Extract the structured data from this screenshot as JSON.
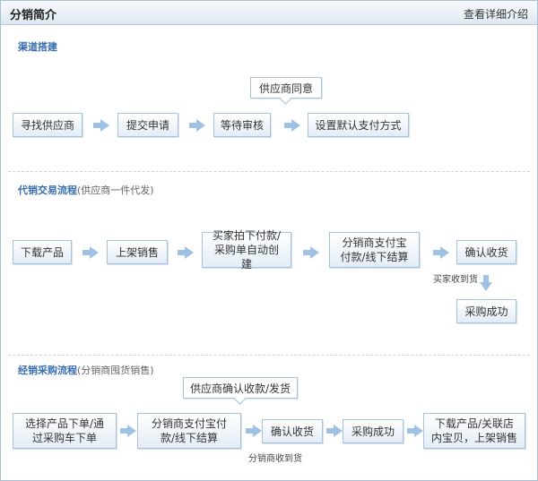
{
  "header": {
    "title": "分销简介",
    "details_link": "查看详细介绍"
  },
  "sections": {
    "channel": {
      "title": "渠道搭建",
      "callout": "供应商同意",
      "steps": [
        "寻找供应商",
        "提交申请",
        "等待审核",
        "设置默认支付方式"
      ]
    },
    "consignment": {
      "title": "代销交易流程",
      "subtitle": "(供应商一件代发)",
      "steps": [
        "下载产品",
        "上架销售",
        "买家拍下付款/采购单自动创建",
        "分销商支付宝付款/线下结算",
        "确认收货",
        "采购成功"
      ],
      "note": "买家收到货"
    },
    "distribution": {
      "title": "经销采购流程",
      "subtitle": "(分销商囤货销售)",
      "callout": "供应商确认收款/发货",
      "steps": [
        "选择产品下单/通过采购车下单",
        "分销商支付宝付款/线下结算",
        "确认收货",
        "采购成功",
        "下载产品/关联店内宝贝，上架销售"
      ],
      "note": "分销商收到货"
    }
  },
  "colors": {
    "accent": "#3a6fb0",
    "box_border": "#a9c2dc",
    "arrow": "#9fc2e4",
    "header_bg": "#dfe8f1"
  }
}
